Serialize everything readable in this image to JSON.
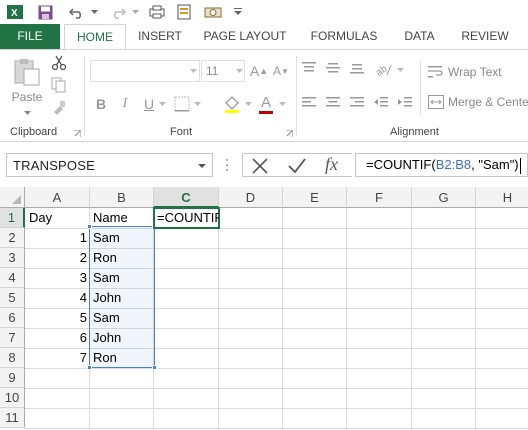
{
  "tabs": {
    "file": "FILE",
    "home": "HOME",
    "insert": "INSERT",
    "page_layout": "PAGE LAYOUT",
    "formulas": "FORMULAS",
    "data": "DATA",
    "review": "REVIEW"
  },
  "ribbon": {
    "clipboard": {
      "label": "Clipboard",
      "paste": "Paste"
    },
    "font": {
      "label": "Font",
      "size": "11",
      "bold": "B",
      "italic": "I",
      "underline": "U",
      "grow": "A",
      "shrink": "A",
      "font_color": "A"
    },
    "alignment": {
      "label": "Alignment",
      "wrap_text": "Wrap Text",
      "merge_center": "Merge & Cente"
    }
  },
  "formula_bar": {
    "name_box": "TRANSPOSE",
    "fx": "fx",
    "formula_prefix": "=COUNTIF(",
    "formula_ref": "B2:B8",
    "formula_suffix": ", \"Sam\")"
  },
  "sheet": {
    "columns": [
      "A",
      "B",
      "C",
      "D",
      "E",
      "F",
      "G",
      "H"
    ],
    "rows": [
      "1",
      "2",
      "3",
      "4",
      "5",
      "6",
      "7",
      "8",
      "9",
      "10",
      "11"
    ],
    "header_row": {
      "a1": "Day",
      "b1": "Name",
      "c1": "=COUNTIF"
    },
    "data_rows": [
      {
        "day": "1",
        "name": "Sam"
      },
      {
        "day": "2",
        "name": "Ron"
      },
      {
        "day": "3",
        "name": "Sam"
      },
      {
        "day": "4",
        "name": "John"
      },
      {
        "day": "5",
        "name": "Sam"
      },
      {
        "day": "6",
        "name": "John"
      },
      {
        "day": "7",
        "name": "Ron"
      }
    ]
  },
  "colors": {
    "accent": "#217346",
    "reference_highlight": "#4a7edd"
  }
}
